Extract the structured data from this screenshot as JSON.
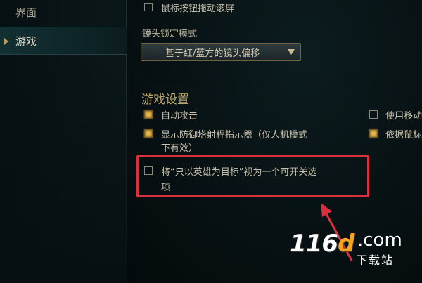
{
  "sidebar": {
    "items": [
      {
        "label": "界面",
        "active": false
      },
      {
        "label": "游戏",
        "active": true
      }
    ]
  },
  "main": {
    "drag_scroll": {
      "label": "鼠标按钮拖动滚屏",
      "checked": false
    },
    "camera_lock": {
      "label": "镜头锁定模式",
      "selected": "基于红/蓝方的镜头偏移"
    },
    "game_settings": {
      "title": "游戏设置",
      "left_options": [
        {
          "label": "自动攻击",
          "checked": true
        },
        {
          "label_line1": "显示防御塔射程指示器（仅人机模式",
          "label_line2": "下有效）",
          "checked": true
        },
        {
          "label_line1": "将“只以英雄为目标”视为一个可开关选",
          "label_line2": "项",
          "checked": false
        }
      ],
      "right_options": [
        {
          "label": "使用移动",
          "checked": false
        },
        {
          "label": "依据鼠标",
          "checked": true
        }
      ]
    }
  },
  "watermark": {
    "number": "116",
    "letter": "d",
    "domain": ".com",
    "subtitle": "下载站"
  },
  "colors": {
    "highlight_border": "#d9303d",
    "checked_fill": "#e3b54c",
    "section_title": "#b9a36c"
  }
}
